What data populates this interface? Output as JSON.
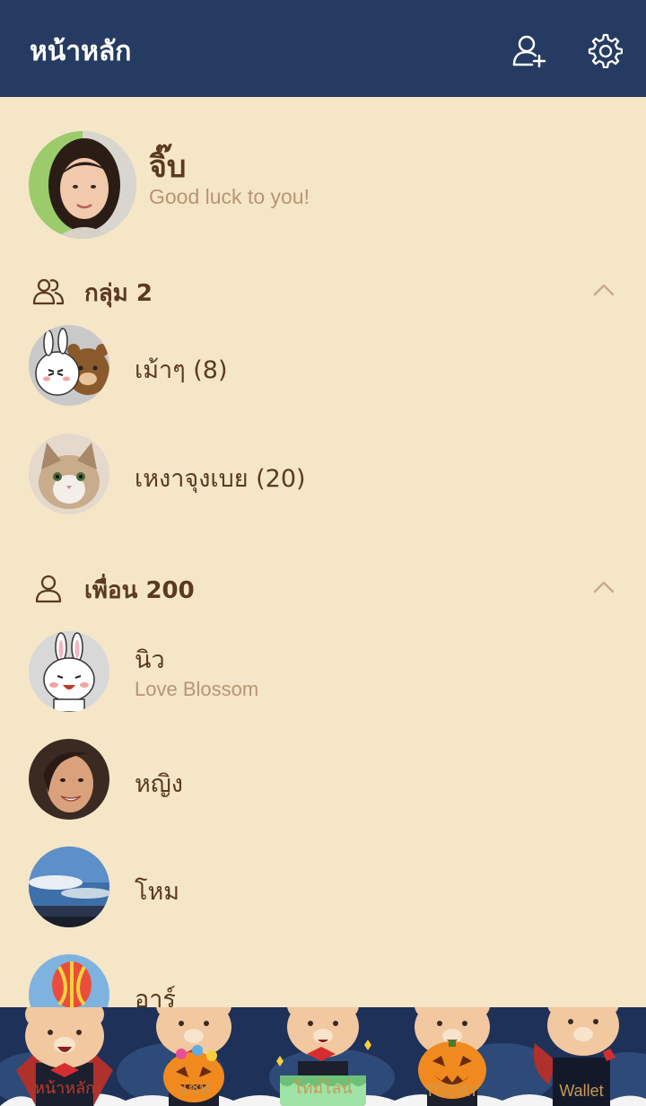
{
  "header": {
    "title": "หน้าหลัก",
    "add_friend_icon": "add-friend-icon",
    "settings_icon": "gear-icon"
  },
  "colors": {
    "header_bg": "#263B62",
    "page_bg": "#F5E6C8",
    "text": "#5A3A1E",
    "muted": "#B89573",
    "tabbar_bg": "#1E3158",
    "tab_label": "#C79A55",
    "tab_active": "#C0392B"
  },
  "profile": {
    "name": "จิ๊บ",
    "status": "Good luck to you!"
  },
  "groups": {
    "label": "กลุ่ม 2",
    "items": [
      {
        "name": "เม้าๆ (8)"
      },
      {
        "name": "เหงาจุงเบย (20)"
      }
    ]
  },
  "friends": {
    "label": "เพื่อน 200",
    "items": [
      {
        "name": "นิว",
        "status": "Love Blossom"
      },
      {
        "name": "หญิง"
      },
      {
        "name": "โหม"
      },
      {
        "name": "อาร์"
      }
    ]
  },
  "tabs": [
    {
      "label": "หน้าหลัก",
      "active": true
    },
    {
      "label": "แชท",
      "active": false
    },
    {
      "label": "ไทม์ไลน์",
      "active": false
    },
    {
      "label": "TODAY",
      "active": false
    },
    {
      "label": "Wallet",
      "active": false
    }
  ]
}
